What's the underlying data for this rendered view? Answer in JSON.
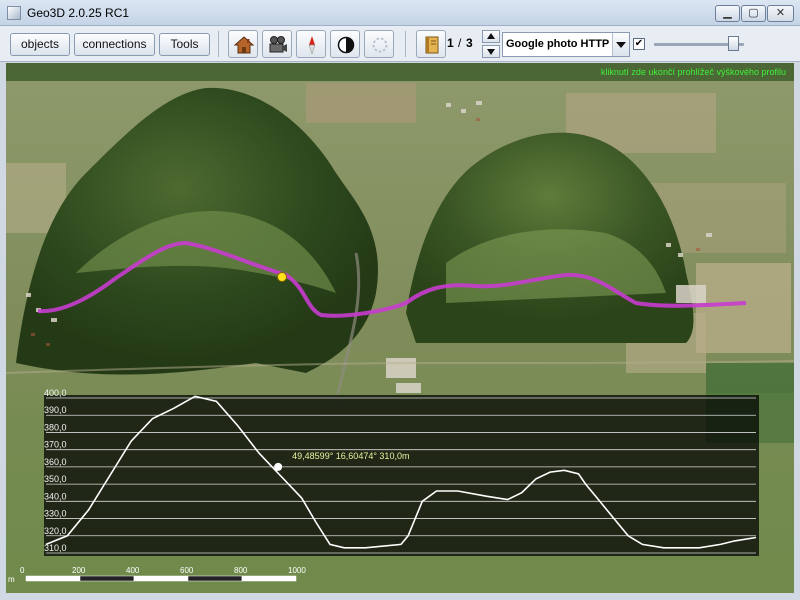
{
  "window": {
    "title": "Geo3D 2.0.25 RC1",
    "controls": [
      "minimize-icon",
      "maximize-icon",
      "close-icon"
    ]
  },
  "toolbar": {
    "buttons": [
      {
        "label": "objects"
      },
      {
        "label": "connections"
      },
      {
        "label": "Tools"
      }
    ],
    "icons": [
      "home-icon",
      "camera-icon",
      "compass-icon",
      "contrast-icon",
      "spinner-icon",
      "book-icon"
    ],
    "page": {
      "current": "1",
      "separator": "/",
      "total": "3"
    },
    "imagery": {
      "selected": "Google photo HTTP"
    },
    "overlay_checkbox": {
      "checked": true,
      "mark": "✔"
    },
    "slider": {
      "value_fraction": 0.88
    }
  },
  "map": {
    "hint_text": "kliknutí zde ukončí prohlížeč výškového profilu",
    "marker_readout": "49,48599°  16,60474°   310,0m",
    "scale": {
      "unit": "m",
      "labels": [
        "0",
        "200",
        "400",
        "600",
        "800",
        "1000"
      ]
    }
  },
  "chart_data": {
    "type": "line",
    "title": "",
    "xlabel": "",
    "ylabel": "",
    "ylim": [
      310,
      400
    ],
    "yticks": [
      "310,0",
      "320,0",
      "330,0",
      "340,0",
      "350,0",
      "360,0",
      "370,0",
      "380,0",
      "390,0",
      "400,0"
    ],
    "series": [
      {
        "x_fraction": [
          0.0,
          0.03,
          0.06,
          0.09,
          0.12,
          0.15,
          0.18,
          0.21,
          0.24,
          0.27,
          0.3,
          0.33,
          0.36,
          0.38,
          0.4,
          0.42,
          0.45,
          0.5,
          0.51,
          0.52,
          0.53,
          0.55,
          0.58,
          0.62,
          0.65,
          0.67,
          0.69,
          0.71,
          0.73,
          0.75,
          0.76,
          0.78,
          0.8,
          0.82,
          0.84,
          0.87,
          0.9,
          0.92,
          0.95,
          0.97,
          1.0
        ],
        "y": [
          315,
          320,
          335,
          355,
          375,
          388,
          394,
          401,
          398,
          384,
          368,
          355,
          342,
          328,
          315,
          313,
          313,
          315,
          320,
          330,
          340,
          346,
          346,
          343,
          341,
          345,
          353,
          357,
          358,
          356,
          350,
          340,
          330,
          320,
          315,
          313,
          313,
          313,
          315,
          317,
          319
        ]
      }
    ],
    "marker": {
      "x_fraction": 0.327,
      "y": 360,
      "color": "#ffffff"
    }
  },
  "colors": {
    "track": "#c83ccf",
    "marker": "#ffe21a",
    "profile_line": "#ffffff",
    "hint": "#3ff03a"
  }
}
